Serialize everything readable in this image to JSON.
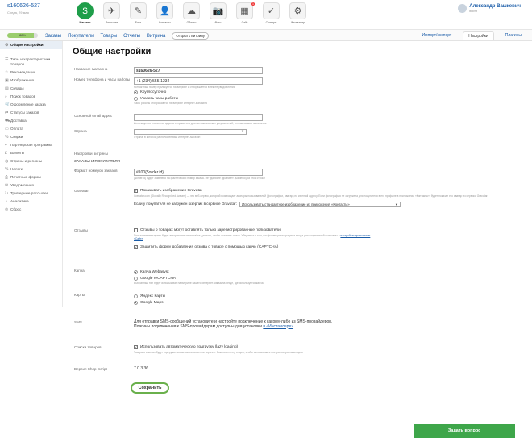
{
  "account": {
    "id": "s160626-527",
    "date": "Среда, 29 мая"
  },
  "apps": [
    {
      "label": "Магазин",
      "icon": "store-icon",
      "color": "#1f9e4a",
      "glyph": "$",
      "active": true,
      "badge": ""
    },
    {
      "label": "Рассылки",
      "icon": "mailer-icon",
      "color": "#f4f4f4",
      "glyph": "✈",
      "active": false,
      "badge": ""
    },
    {
      "label": "Блог",
      "icon": "blog-icon",
      "color": "#f4f4f4",
      "glyph": "✎",
      "active": false,
      "badge": ""
    },
    {
      "label": "Контакты",
      "icon": "contacts-icon",
      "color": "#f4f4f4",
      "glyph": "👤",
      "active": false,
      "badge": ""
    },
    {
      "label": "Облако",
      "icon": "cloud-icon",
      "color": "#f4f4f4",
      "glyph": "☁",
      "active": false,
      "badge": ""
    },
    {
      "label": "Фото",
      "icon": "photo-icon",
      "color": "#f4f4f4",
      "glyph": "📷",
      "active": false,
      "badge": ""
    },
    {
      "label": "Сайт",
      "icon": "site-icon",
      "color": "#f4f4f4",
      "glyph": "▦",
      "active": false,
      "badge": "1"
    },
    {
      "label": "Стикеры",
      "icon": "stickers-icon",
      "color": "#f4f4f4",
      "glyph": "✓",
      "active": false,
      "badge": ""
    },
    {
      "label": "Инсталлер",
      "icon": "installer-icon",
      "color": "#f4f4f4",
      "glyph": "⚙",
      "active": false,
      "badge": ""
    }
  ],
  "user": {
    "name": "Александр Вашкевич",
    "logout": "выйти"
  },
  "nav": {
    "progress_label": "88%",
    "progress": 0.88,
    "links": [
      "Заказы",
      "Покупатели",
      "Товары",
      "Отчеты",
      "Витрина"
    ],
    "open_storefront": "Открыть витрину",
    "right": [
      "Импорт/экспорт",
      "Настройки",
      "Плагины"
    ],
    "selected_right": "Настройки"
  },
  "sidebar": [
    {
      "label": "Общие настройки",
      "icon": "settings-icon",
      "glyph": "⚙",
      "sel": true
    },
    {
      "label": "Типы и характеристики товаров",
      "icon": "list-icon",
      "glyph": "☰",
      "sel": false
    },
    {
      "label": "Рекомендации",
      "icon": "star-icon",
      "glyph": "☆",
      "sel": false
    },
    {
      "label": "Изображения",
      "icon": "image-icon",
      "glyph": "▣",
      "sel": false
    },
    {
      "label": "Склады",
      "icon": "warehouse-icon",
      "glyph": "▤",
      "sel": false
    },
    {
      "label": "Поиск товаров",
      "icon": "search-icon",
      "glyph": "⌕",
      "sel": false
    },
    {
      "label": "Оформление заказа",
      "icon": "cart-icon",
      "glyph": "🛒",
      "sel": false
    },
    {
      "label": "Статусы заказов",
      "icon": "workflow-icon",
      "glyph": "⇄",
      "sel": false
    },
    {
      "label": "Доставка",
      "icon": "truck-icon",
      "glyph": "⛟",
      "sel": false
    },
    {
      "label": "Оплата",
      "icon": "card-icon",
      "glyph": "▭",
      "sel": false
    },
    {
      "label": "Скидки",
      "icon": "discount-icon",
      "glyph": "%",
      "sel": false
    },
    {
      "label": "Партнерская программа",
      "icon": "affiliate-icon",
      "glyph": "♥",
      "sel": false
    },
    {
      "label": "Валюты",
      "icon": "currency-icon",
      "glyph": "£",
      "sel": false
    },
    {
      "label": "Страны и регионы",
      "icon": "globe-icon",
      "glyph": "◍",
      "sel": false
    },
    {
      "label": "Налоги",
      "icon": "tax-icon",
      "glyph": "%",
      "sel": false
    },
    {
      "label": "Печатные формы",
      "icon": "print-icon",
      "glyph": "⎙",
      "sel": false
    },
    {
      "label": "Уведомления",
      "icon": "notification-icon",
      "glyph": "✉",
      "sel": false
    },
    {
      "label": "Триггерные рассылки",
      "icon": "trigger-icon",
      "glyph": "↻",
      "sel": false
    },
    {
      "label": "Аналитика",
      "icon": "analytics-icon",
      "glyph": "◔",
      "sel": false
    },
    {
      "label": "Сброс",
      "icon": "reset-icon",
      "glyph": "⊘",
      "sel": false
    }
  ],
  "page": {
    "title": "Общие настройки"
  },
  "fields": {
    "shop_name_label": "Название магазина",
    "shop_name_value": "s160626-527",
    "phone_label": "Номер телефона и часы работы",
    "phone_value": "+1 (234) 555-1234",
    "phone_hint": "Контактный номер публикуется на витрине и отображается в тексте уведомлений",
    "hours_opt1": "Круглосуточно",
    "hours_opt2": "Указать часы работы",
    "hours_hint": "Часы работы отображаются на витрине интернет-магазина",
    "email_label": "Основной email адрес",
    "email_value": "",
    "email_hint": "Используется в качестве адреса отправителя для автоматических уведомлений, отправляемых магазином",
    "country_label": "Страна",
    "country_value": "",
    "country_hint": "Страна, в которой расположен ваш интернет-магазин",
    "storefront_label": "Настройки витрины",
    "orders_section": "ЗАКАЗЫ И ПОКУПАТЕЛИ",
    "order_format_label": "Формат номеров заказов",
    "order_format_value": "#100{$order.id}",
    "order_format_hint": "{$order.id} будет заменено на фактический номер заказа. Не удаляйте фрагмент {$order.id} из этой строки",
    "gravatar_label": "Gravatar",
    "gravatar_check": "Показывать изображения Gravatar",
    "gravatar_hint": "Gravatar.com (Globally Recognized Avatars) — это веб-сервис, который возвращает аватары пользователей (фотографии, аватар) по их email адресу. Если фотография не загружена для покупателя в его профиле в приложении «Контакты», будет показан его аватар из сервиса Gravatar.",
    "gravatar_fallback_label": "Если у покупателя не загружен юзерпик в сервисе Gravatar:",
    "gravatar_fallback_value": "Использовать стандартное изображение из приложения «Контакты»",
    "reviews_label": "Отзывы",
    "reviews_check1": "Отзывы о товарах могут оставлять только зарегистрированные пользователи",
    "reviews_hint": "Пользователям нужно будет авторизоваться на сайте для того, чтобы оставить отзыв. Убедитесь в том, что формы регистрации и входа для покупателей включены в",
    "reviews_hint_link": "настройках приложения «Сайт»",
    "reviews_check2": "Защитить форму добавления отзыва о товаре с помощью капчи (CAPTCHA)",
    "captcha_label": "Капча",
    "captcha_opt1": "Капча Webasyst",
    "captcha_opt2": "Google reCAPTCHA",
    "captcha_hint": "Выбранный тип будет использован на витрине вашего интернет-магазина везде, где используется капча",
    "maps_label": "Карты",
    "maps_opt1": "Яндекс Карты",
    "maps_opt2": "Google Maps",
    "sms_label": "SMS",
    "sms_text1": "Для отправки SMS-сообщений установите и настройте подключение к какому-либо из SMS-провайдеров.",
    "sms_text2": "Плагины подключения к SMS-провайдерам доступны для установки",
    "sms_link": "в «Инсталлере»",
    "list_label": "Списки товаров",
    "list_check": "Использовать автоматическую подгрузку (lazy loading)",
    "list_hint": "Товары в списках будут подгружаться автоматически при скролле. Выключите эту опцию, чтобы использовать постраничную навигацию.",
    "version_label": "Версия Shop-Script",
    "version_value": "7.0.3.36",
    "save": "Сохранить"
  },
  "help_button": "Задать вопрос"
}
